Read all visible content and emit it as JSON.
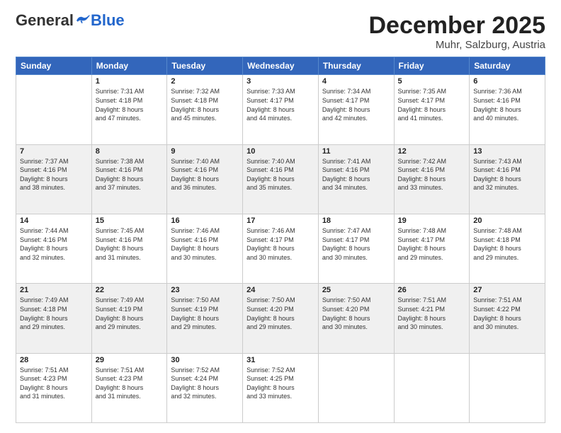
{
  "header": {
    "logo_general": "General",
    "logo_blue": "Blue",
    "month_title": "December 2025",
    "location": "Muhr, Salzburg, Austria"
  },
  "days_of_week": [
    "Sunday",
    "Monday",
    "Tuesday",
    "Wednesday",
    "Thursday",
    "Friday",
    "Saturday"
  ],
  "weeks": [
    {
      "cells": [
        {
          "day": "",
          "content": ""
        },
        {
          "day": "1",
          "content": "Sunrise: 7:31 AM\nSunset: 4:18 PM\nDaylight: 8 hours\nand 47 minutes."
        },
        {
          "day": "2",
          "content": "Sunrise: 7:32 AM\nSunset: 4:18 PM\nDaylight: 8 hours\nand 45 minutes."
        },
        {
          "day": "3",
          "content": "Sunrise: 7:33 AM\nSunset: 4:17 PM\nDaylight: 8 hours\nand 44 minutes."
        },
        {
          "day": "4",
          "content": "Sunrise: 7:34 AM\nSunset: 4:17 PM\nDaylight: 8 hours\nand 42 minutes."
        },
        {
          "day": "5",
          "content": "Sunrise: 7:35 AM\nSunset: 4:17 PM\nDaylight: 8 hours\nand 41 minutes."
        },
        {
          "day": "6",
          "content": "Sunrise: 7:36 AM\nSunset: 4:16 PM\nDaylight: 8 hours\nand 40 minutes."
        }
      ]
    },
    {
      "cells": [
        {
          "day": "7",
          "content": "Sunrise: 7:37 AM\nSunset: 4:16 PM\nDaylight: 8 hours\nand 38 minutes."
        },
        {
          "day": "8",
          "content": "Sunrise: 7:38 AM\nSunset: 4:16 PM\nDaylight: 8 hours\nand 37 minutes."
        },
        {
          "day": "9",
          "content": "Sunrise: 7:40 AM\nSunset: 4:16 PM\nDaylight: 8 hours\nand 36 minutes."
        },
        {
          "day": "10",
          "content": "Sunrise: 7:40 AM\nSunset: 4:16 PM\nDaylight: 8 hours\nand 35 minutes."
        },
        {
          "day": "11",
          "content": "Sunrise: 7:41 AM\nSunset: 4:16 PM\nDaylight: 8 hours\nand 34 minutes."
        },
        {
          "day": "12",
          "content": "Sunrise: 7:42 AM\nSunset: 4:16 PM\nDaylight: 8 hours\nand 33 minutes."
        },
        {
          "day": "13",
          "content": "Sunrise: 7:43 AM\nSunset: 4:16 PM\nDaylight: 8 hours\nand 32 minutes."
        }
      ]
    },
    {
      "cells": [
        {
          "day": "14",
          "content": "Sunrise: 7:44 AM\nSunset: 4:16 PM\nDaylight: 8 hours\nand 32 minutes."
        },
        {
          "day": "15",
          "content": "Sunrise: 7:45 AM\nSunset: 4:16 PM\nDaylight: 8 hours\nand 31 minutes."
        },
        {
          "day": "16",
          "content": "Sunrise: 7:46 AM\nSunset: 4:16 PM\nDaylight: 8 hours\nand 30 minutes."
        },
        {
          "day": "17",
          "content": "Sunrise: 7:46 AM\nSunset: 4:17 PM\nDaylight: 8 hours\nand 30 minutes."
        },
        {
          "day": "18",
          "content": "Sunrise: 7:47 AM\nSunset: 4:17 PM\nDaylight: 8 hours\nand 30 minutes."
        },
        {
          "day": "19",
          "content": "Sunrise: 7:48 AM\nSunset: 4:17 PM\nDaylight: 8 hours\nand 29 minutes."
        },
        {
          "day": "20",
          "content": "Sunrise: 7:48 AM\nSunset: 4:18 PM\nDaylight: 8 hours\nand 29 minutes."
        }
      ]
    },
    {
      "cells": [
        {
          "day": "21",
          "content": "Sunrise: 7:49 AM\nSunset: 4:18 PM\nDaylight: 8 hours\nand 29 minutes."
        },
        {
          "day": "22",
          "content": "Sunrise: 7:49 AM\nSunset: 4:19 PM\nDaylight: 8 hours\nand 29 minutes."
        },
        {
          "day": "23",
          "content": "Sunrise: 7:50 AM\nSunset: 4:19 PM\nDaylight: 8 hours\nand 29 minutes."
        },
        {
          "day": "24",
          "content": "Sunrise: 7:50 AM\nSunset: 4:20 PM\nDaylight: 8 hours\nand 29 minutes."
        },
        {
          "day": "25",
          "content": "Sunrise: 7:50 AM\nSunset: 4:20 PM\nDaylight: 8 hours\nand 30 minutes."
        },
        {
          "day": "26",
          "content": "Sunrise: 7:51 AM\nSunset: 4:21 PM\nDaylight: 8 hours\nand 30 minutes."
        },
        {
          "day": "27",
          "content": "Sunrise: 7:51 AM\nSunset: 4:22 PM\nDaylight: 8 hours\nand 30 minutes."
        }
      ]
    },
    {
      "cells": [
        {
          "day": "28",
          "content": "Sunrise: 7:51 AM\nSunset: 4:23 PM\nDaylight: 8 hours\nand 31 minutes."
        },
        {
          "day": "29",
          "content": "Sunrise: 7:51 AM\nSunset: 4:23 PM\nDaylight: 8 hours\nand 31 minutes."
        },
        {
          "day": "30",
          "content": "Sunrise: 7:52 AM\nSunset: 4:24 PM\nDaylight: 8 hours\nand 32 minutes."
        },
        {
          "day": "31",
          "content": "Sunrise: 7:52 AM\nSunset: 4:25 PM\nDaylight: 8 hours\nand 33 minutes."
        },
        {
          "day": "",
          "content": ""
        },
        {
          "day": "",
          "content": ""
        },
        {
          "day": "",
          "content": ""
        }
      ]
    }
  ]
}
